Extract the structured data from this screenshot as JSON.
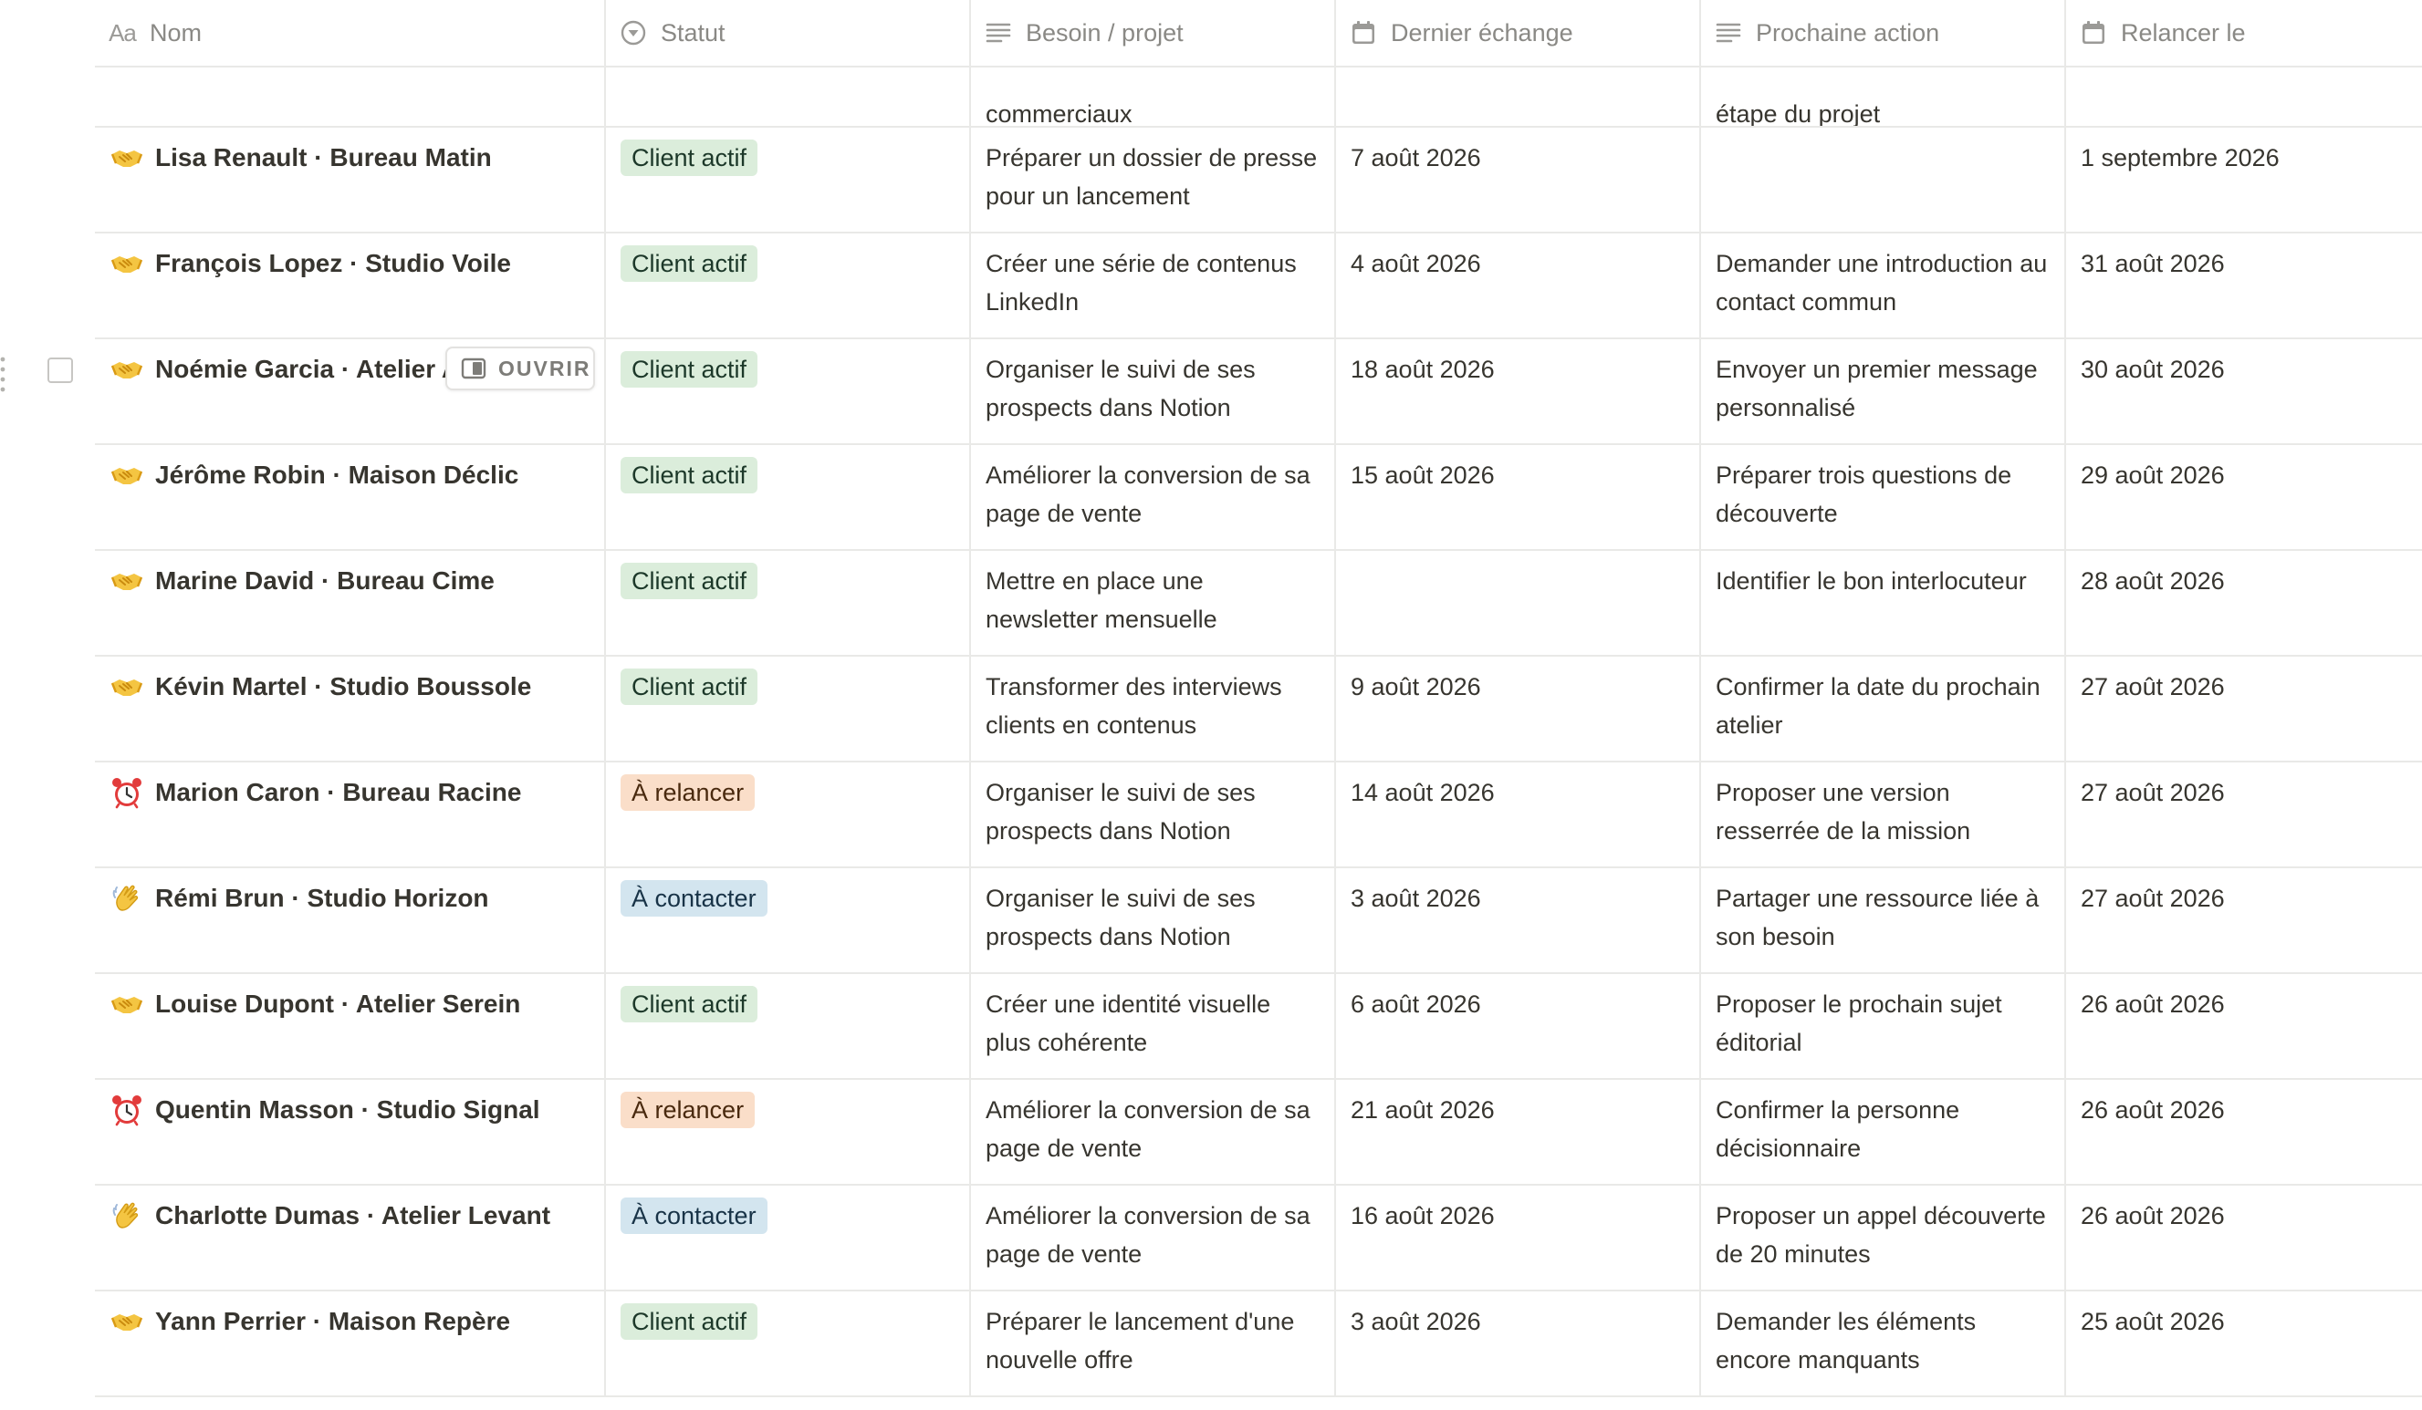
{
  "columns": [
    {
      "icon": "text-aa-icon",
      "label": "Nom"
    },
    {
      "icon": "status-icon",
      "label": "Statut"
    },
    {
      "icon": "text-lines-icon",
      "label": "Besoin / projet"
    },
    {
      "icon": "calendar-icon",
      "label": "Dernier échange"
    },
    {
      "icon": "text-lines-icon",
      "label": "Prochaine action"
    },
    {
      "icon": "calendar-icon",
      "label": "Relancer le"
    }
  ],
  "partial_row": {
    "besoin": "commerciaux",
    "action": "étape du projet"
  },
  "open_button_label": "OUVRIR",
  "rows": [
    {
      "emoji": "handshake",
      "name": "Lisa Renault · Bureau Matin",
      "status": "Client actif",
      "status_kind": "active",
      "besoin": "Préparer un dossier de presse pour un lancement",
      "dernier": "7 août 2026",
      "action": "",
      "relancer": "1 septembre 2026"
    },
    {
      "emoji": "handshake",
      "name": "François Lopez · Studio Voile",
      "status": "Client actif",
      "status_kind": "active",
      "besoin": "Créer une série de contenus LinkedIn",
      "dernier": "4 août 2026",
      "action": "Demander une introduction au contact commun",
      "relancer": "31 août 2026"
    },
    {
      "emoji": "handshake",
      "name": "Noémie Garcia · Atelier A",
      "status": "Client actif",
      "status_kind": "active",
      "besoin": "Organiser le suivi de ses prospects dans Notion",
      "dernier": "18 août 2026",
      "action": "Envoyer un premier message personnalisé",
      "relancer": "30 août 2026"
    },
    {
      "emoji": "handshake",
      "name": "Jérôme Robin · Maison Déclic",
      "status": "Client actif",
      "status_kind": "active",
      "besoin": "Améliorer la conversion de sa page de vente",
      "dernier": "15 août 2026",
      "action": "Préparer trois questions de découverte",
      "relancer": "29 août 2026"
    },
    {
      "emoji": "handshake",
      "name": "Marine David · Bureau Cime",
      "status": "Client actif",
      "status_kind": "active",
      "besoin": "Mettre en place une newsletter mensuelle",
      "dernier": "",
      "action": "Identifier le bon interlocuteur",
      "relancer": "28 août 2026"
    },
    {
      "emoji": "handshake",
      "name": "Kévin Martel · Studio Boussole",
      "status": "Client actif",
      "status_kind": "active",
      "besoin": "Transformer des interviews clients en contenus",
      "dernier": "9 août 2026",
      "action": "Confirmer la date du prochain atelier",
      "relancer": "27 août 2026"
    },
    {
      "emoji": "alarm",
      "name": "Marion Caron · Bureau Racine",
      "status": "À relancer",
      "status_kind": "relance",
      "besoin": "Organiser le suivi de ses prospects dans Notion",
      "dernier": "14 août 2026",
      "action": "Proposer une version resserrée de la mission",
      "relancer": "27 août 2026"
    },
    {
      "emoji": "wave",
      "name": "Rémi Brun · Studio Horizon",
      "status": "À contacter",
      "status_kind": "contact",
      "besoin": "Organiser le suivi de ses prospects dans Notion",
      "dernier": "3 août 2026",
      "action": "Partager une ressource liée à son besoin",
      "relancer": "27 août 2026"
    },
    {
      "emoji": "handshake",
      "name": "Louise Dupont · Atelier Serein",
      "status": "Client actif",
      "status_kind": "active",
      "besoin": "Créer une identité visuelle plus cohérente",
      "dernier": "6 août 2026",
      "action": "Proposer le prochain sujet éditorial",
      "relancer": "26 août 2026"
    },
    {
      "emoji": "alarm",
      "name": "Quentin Masson · Studio Signal",
      "status": "À relancer",
      "status_kind": "relance",
      "besoin": "Améliorer la conversion de sa page de vente",
      "dernier": "21 août 2026",
      "action": "Confirmer la personne décisionnaire",
      "relancer": "26 août 2026"
    },
    {
      "emoji": "wave",
      "name": "Charlotte Dumas · Atelier Levant",
      "status": "À contacter",
      "status_kind": "contact",
      "besoin": "Améliorer la conversion de sa page de vente",
      "dernier": "16 août 2026",
      "action": "Proposer un appel découverte de 20 minutes",
      "relancer": "26 août 2026"
    },
    {
      "emoji": "handshake",
      "name": "Yann Perrier · Maison Repère",
      "status": "Client actif",
      "status_kind": "active",
      "besoin": "Préparer le lancement d'une nouvelle offre",
      "dernier": "3 août 2026",
      "action": "Demander les éléments encore manquants",
      "relancer": "25 août 2026"
    }
  ]
}
